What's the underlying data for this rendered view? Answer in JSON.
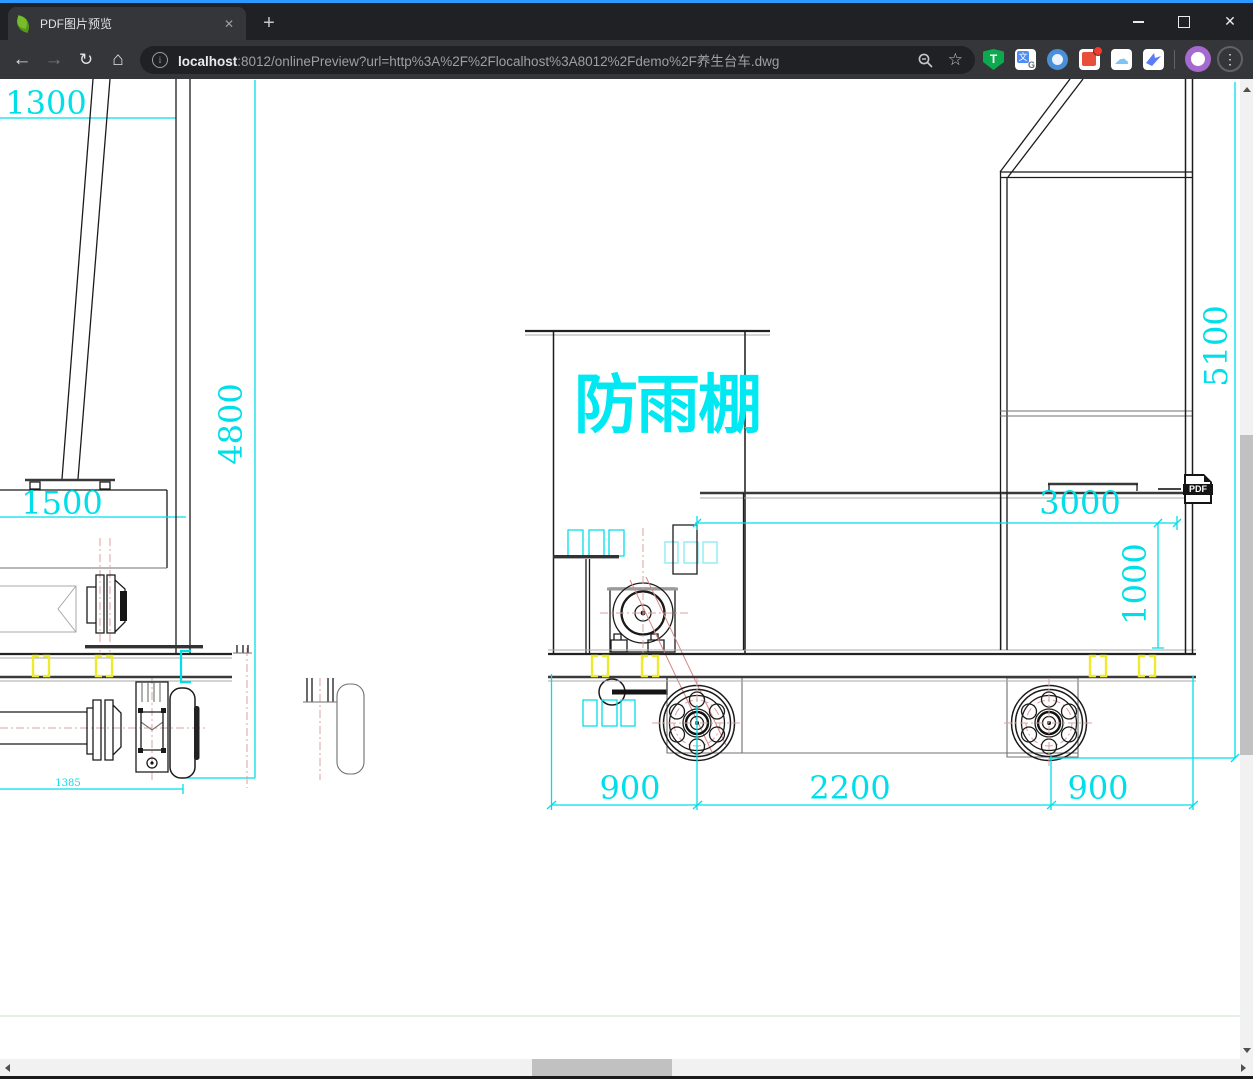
{
  "browser": {
    "tab": {
      "title": "PDF图片预览",
      "close_icon": "✕",
      "new_tab_icon": "+"
    },
    "window_controls": {
      "close": "✕"
    },
    "toolbar": {
      "back_icon": "←",
      "forward_icon": "→",
      "reload_icon": "↻",
      "home_icon": "⌂",
      "info_icon": "i",
      "star_icon": "☆",
      "url_host": "localhost",
      "url_rest": ":8012/onlinePreview?url=http%3A%2F%2Flocalhost%3A8012%2Fdemo%2F养生台车.dwg",
      "tampermonkey_letter": "T"
    }
  },
  "drawing": {
    "labels": {
      "rain_shelter": "防雨棚"
    },
    "dimensions": {
      "top_width": "1300",
      "total_height": "4800",
      "platform_width": "1500",
      "axle_span": "1385",
      "tank_width": "3000",
      "tank_height": "1000",
      "frame_height": "5100",
      "front_overhang": "900",
      "wheelbase": "2200",
      "rear_overhang": "900"
    },
    "pdf_badge_label": "PDF",
    "colors": {
      "dimension_cyan": "#00dfe9",
      "highlight_yellow": "#eeea2d",
      "centerline_red": "#dba0a0",
      "accent_blue_top": "#2b99ff"
    }
  }
}
